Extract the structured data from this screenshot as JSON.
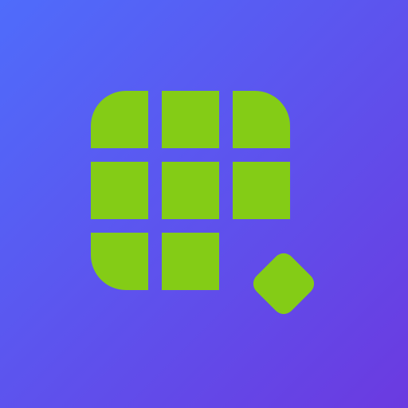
{
  "colors": {
    "background_start": "#4f6cfb",
    "background_end": "#6b3ae0",
    "tile": "#84cc16"
  },
  "icon": {
    "name": "grid-with-diamond-icon",
    "grid": {
      "rows": 3,
      "cols": 3,
      "missing_cell": "bottom-right"
    },
    "accent_shape": "rounded-diamond"
  }
}
